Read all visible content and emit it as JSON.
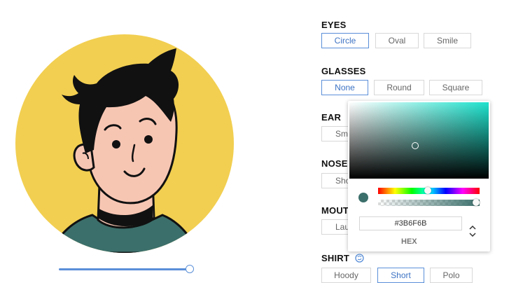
{
  "avatar": {
    "colors": {
      "background": "#f2cf51",
      "skin": "#f7c6b3",
      "hair": "#111111",
      "shirt": "#3b6f6b"
    }
  },
  "size_slider": {
    "value": 1.0
  },
  "sections": {
    "eyes": {
      "title": "EYES",
      "options": [
        "Circle",
        "Oval",
        "Smile"
      ],
      "selected": "Circle"
    },
    "glasses": {
      "title": "GLASSES",
      "options": [
        "None",
        "Round",
        "Square"
      ],
      "selected": "None"
    },
    "ear": {
      "title": "EAR",
      "options": [
        "Sma"
      ]
    },
    "nose": {
      "title": "NOSE",
      "options": [
        "Sho"
      ]
    },
    "mouth": {
      "title": "MOUTH",
      "options": [
        "Lau"
      ]
    },
    "shirt": {
      "title": "SHIRT",
      "options": [
        "Hoody",
        "Short",
        "Polo"
      ],
      "selected": "Short",
      "icon": "color-palette-icon"
    }
  },
  "color_picker": {
    "hex_value": "#3B6F6B",
    "mode_label": "HEX",
    "hue_level": 0.49,
    "alpha_level": 1.0,
    "colors": {
      "current": "#3b6f6b",
      "saturation_hue": "#1de2cd"
    }
  }
}
